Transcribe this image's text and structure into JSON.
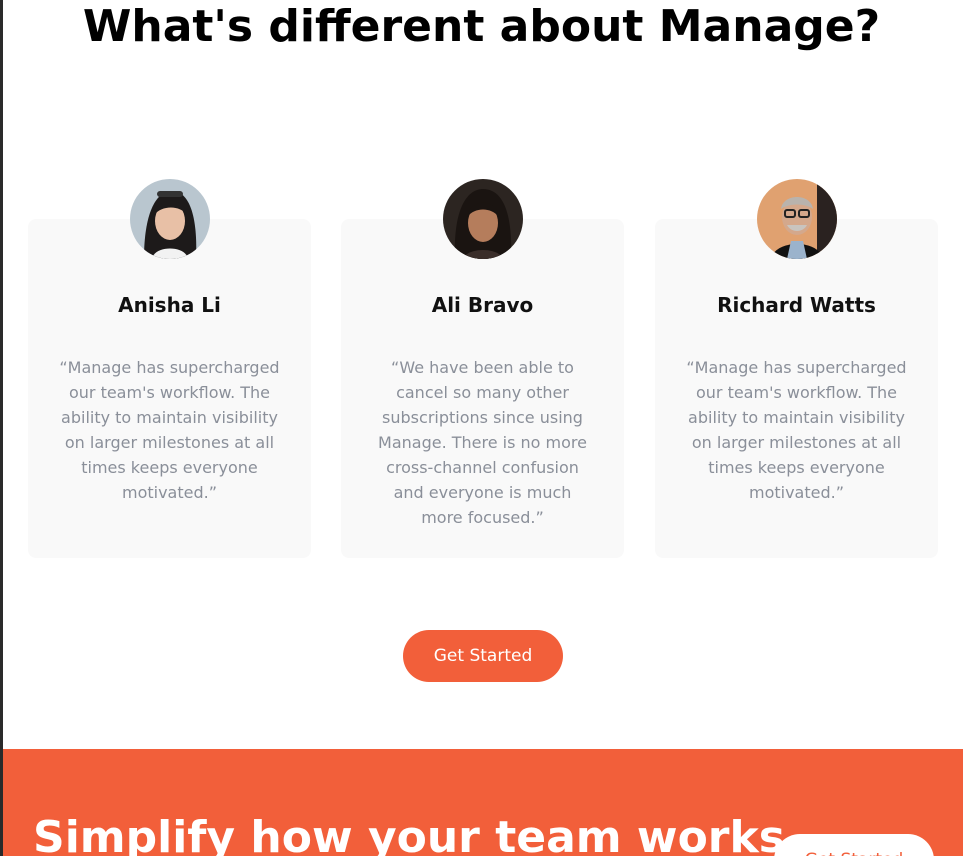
{
  "page": {
    "title": "What's different about Manage?"
  },
  "testimonials": [
    {
      "name": "Anisha Li",
      "quote": "“Manage has supercharged our team's workflow. The ability to maintain visibility on larger milestones at all times keeps everyone motivated.”"
    },
    {
      "name": "Ali Bravo",
      "quote": "“We have been able to cancel so many other subscriptions since using Manage. There is no more cross-channel confusion and everyone is much more focused.”"
    },
    {
      "name": "Richard Watts",
      "quote": "“Manage has supercharged our team's workflow. The ability to maintain visibility on larger milestones at all times keeps everyone motivated.”"
    }
  ],
  "cta": {
    "label": "Get Started"
  },
  "footer": {
    "title": "Simplify how your team works",
    "button_label": "Get Started"
  },
  "colors": {
    "accent": "#f25f3a",
    "card_bg": "#f9f9f9",
    "quote_text": "#8a8f99"
  }
}
